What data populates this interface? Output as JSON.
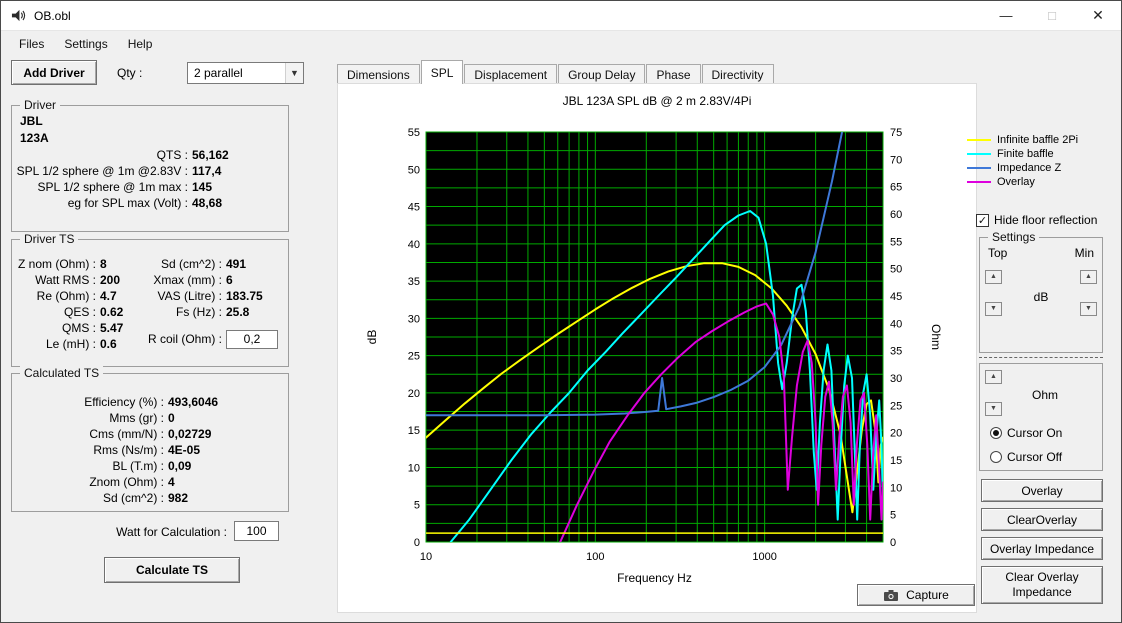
{
  "window": {
    "title": "OB.obl",
    "controls": {
      "minimize": "—",
      "maximize": "□",
      "close": "✕"
    }
  },
  "icons": {
    "spin_up": "▲",
    "spin_down": "▼",
    "combo_arrow": "▼",
    "check": "✓"
  },
  "menu": {
    "items": [
      "Files",
      "Settings",
      "Help"
    ]
  },
  "left": {
    "add_driver": "Add Driver",
    "qty_label": "Qty :",
    "qty_value": "2 parallel",
    "driver": {
      "title": "Driver",
      "name1": "JBL",
      "name2": "123A",
      "fields": [
        {
          "label": "QTS :",
          "value": "56,162"
        },
        {
          "label": "SPL 1/2 sphere @ 1m @2.83V :",
          "value": "117,4"
        },
        {
          "label": "SPL 1/2 sphere @ 1m max :",
          "value": "145"
        },
        {
          "label": "eg for SPL max (Volt) :",
          "value": "48,68"
        }
      ]
    },
    "driver_ts": {
      "title": "Driver TS",
      "col1": [
        {
          "label": "Z nom (Ohm) :",
          "value": "8"
        },
        {
          "label": "Watt RMS :",
          "value": "200"
        },
        {
          "label": "Re (Ohm) :",
          "value": "4.7"
        },
        {
          "label": "QES :",
          "value": "0.62"
        },
        {
          "label": "QMS :",
          "value": "5.47"
        },
        {
          "label": "Le (mH) :",
          "value": "0.6"
        }
      ],
      "col2": [
        {
          "label": "Sd (cm^2) :",
          "value": "491"
        },
        {
          "label": "Xmax (mm) :",
          "value": "6"
        },
        {
          "label": "VAS (Litre) :",
          "value": "183.75"
        },
        {
          "label": "Fs (Hz) :",
          "value": "25.8"
        }
      ],
      "rcoil": {
        "label": "R coil (Ohm) :",
        "value": "0,2"
      }
    },
    "calculated_ts": {
      "title": "Calculated TS",
      "fields": [
        {
          "label": "Efficiency (%) :",
          "value": "493,6046"
        },
        {
          "label": "Mms (gr) :",
          "value": "0"
        },
        {
          "label": "Cms (mm/N) :",
          "value": "0,02729"
        },
        {
          "label": "Rms (Ns/m) :",
          "value": "4E-05"
        },
        {
          "label": "BL (T.m) :",
          "value": "0,09"
        },
        {
          "label": "Znom (Ohm) :",
          "value": "4"
        },
        {
          "label": "Sd (cm^2) :",
          "value": "982"
        }
      ]
    },
    "watt_label": "Watt for Calculation :",
    "watt_value": "100",
    "calculate_button": "Calculate TS"
  },
  "tabs": {
    "active": "SPL",
    "items": [
      {
        "label": "Dimensions"
      },
      {
        "label": "SPL"
      },
      {
        "label": "Displacement"
      },
      {
        "label": "Group Delay"
      },
      {
        "label": "Phase"
      },
      {
        "label": "Directivity"
      }
    ]
  },
  "chart_data": {
    "type": "line",
    "title": "JBL 123A SPL dB @ 2 m 2.83V/4Pi",
    "xlabel": "Frequency Hz",
    "ylabel_left": "dB",
    "ylabel_right": "Ohm",
    "x_scale": "log",
    "x_range": [
      10,
      5000
    ],
    "x_ticks": [
      10,
      100,
      1000
    ],
    "y_left": {
      "range": [
        0,
        55
      ],
      "ticks": [
        0,
        5,
        10,
        15,
        20,
        25,
        30,
        35,
        40,
        45,
        50,
        55
      ],
      "grid_step": 2.5
    },
    "y_right": {
      "range": [
        0,
        75
      ],
      "ticks": [
        0,
        5,
        10,
        15,
        20,
        25,
        30,
        35,
        40,
        45,
        50,
        55,
        60,
        65,
        70,
        75
      ]
    },
    "plot_bg": "#000000",
    "grid_color": "#00aa00",
    "grid": true,
    "legend_position": "top-right-outside",
    "series": [
      {
        "name": "Infinite baffle 2Pi",
        "color": "#ffff00",
        "axis": "left",
        "width": 2,
        "points": [
          [
            10,
            14
          ],
          [
            13,
            16.3
          ],
          [
            17,
            18.6
          ],
          [
            22,
            20.7
          ],
          [
            28,
            22.6
          ],
          [
            36,
            24.4
          ],
          [
            46,
            26.1
          ],
          [
            60,
            27.9
          ],
          [
            78,
            29.6
          ],
          [
            100,
            31.2
          ],
          [
            128,
            32.7
          ],
          [
            165,
            34.1
          ],
          [
            210,
            35.3
          ],
          [
            270,
            36.3
          ],
          [
            345,
            37
          ],
          [
            440,
            37.4
          ],
          [
            560,
            37.4
          ],
          [
            700,
            36.9
          ],
          [
            880,
            35.8
          ],
          [
            1100,
            34
          ],
          [
            1350,
            31.7
          ],
          [
            1650,
            28.8
          ],
          [
            2000,
            25.2
          ],
          [
            2400,
            20.5
          ],
          [
            2800,
            14.5
          ],
          [
            3100,
            8
          ],
          [
            3300,
            4
          ],
          [
            3500,
            9
          ],
          [
            3750,
            15
          ],
          [
            4000,
            18.5
          ],
          [
            4250,
            19
          ],
          [
            4500,
            15
          ],
          [
            4700,
            8
          ],
          [
            4850,
            13
          ],
          [
            5000,
            14
          ]
        ]
      },
      {
        "name": "Finite baffle",
        "color": "#00ffff",
        "axis": "left",
        "width": 2,
        "points": [
          [
            14,
            0
          ],
          [
            18,
            3
          ],
          [
            24,
            7
          ],
          [
            32,
            11
          ],
          [
            42,
            14.5
          ],
          [
            55,
            17.5
          ],
          [
            70,
            20
          ],
          [
            90,
            23
          ],
          [
            115,
            25.5
          ],
          [
            145,
            28
          ],
          [
            185,
            30.5
          ],
          [
            235,
            33
          ],
          [
            300,
            35.5
          ],
          [
            380,
            38
          ],
          [
            480,
            40.5
          ],
          [
            580,
            42.5
          ],
          [
            700,
            43.8
          ],
          [
            820,
            44.4
          ],
          [
            920,
            43.5
          ],
          [
            1020,
            40
          ],
          [
            1120,
            33
          ],
          [
            1200,
            24
          ],
          [
            1270,
            20.5
          ],
          [
            1350,
            24
          ],
          [
            1450,
            30
          ],
          [
            1550,
            34
          ],
          [
            1650,
            34.5
          ],
          [
            1750,
            31
          ],
          [
            1850,
            23
          ],
          [
            1950,
            12
          ],
          [
            2030,
            7
          ],
          [
            2120,
            16
          ],
          [
            2230,
            23
          ],
          [
            2350,
            26.5
          ],
          [
            2480,
            23
          ],
          [
            2600,
            12
          ],
          [
            2700,
            3
          ],
          [
            2820,
            13
          ],
          [
            2950,
            21
          ],
          [
            3100,
            25
          ],
          [
            3280,
            22
          ],
          [
            3420,
            11
          ],
          [
            3520,
            3
          ],
          [
            3650,
            13
          ],
          [
            3820,
            20
          ],
          [
            4000,
            22.5
          ],
          [
            4200,
            17
          ],
          [
            4380,
            7
          ],
          [
            4550,
            14
          ],
          [
            4750,
            19
          ],
          [
            4900,
            13
          ],
          [
            5000,
            5
          ]
        ]
      },
      {
        "name": "Impedance Z",
        "color": "#3e78d8",
        "axis": "right",
        "width": 2,
        "points": [
          [
            10,
            23.2
          ],
          [
            50,
            23.2
          ],
          [
            100,
            23.3
          ],
          [
            150,
            23.5
          ],
          [
            200,
            23.8
          ],
          [
            235,
            24
          ],
          [
            248,
            30
          ],
          [
            262,
            24.3
          ],
          [
            320,
            24.8
          ],
          [
            400,
            25.5
          ],
          [
            500,
            26.5
          ],
          [
            630,
            27.8
          ],
          [
            800,
            29.5
          ],
          [
            1000,
            32
          ],
          [
            1250,
            36
          ],
          [
            1600,
            43
          ],
          [
            2000,
            53
          ],
          [
            2500,
            66
          ],
          [
            3000,
            78
          ],
          [
            3200,
            85
          ]
        ]
      },
      {
        "name": "Overlay",
        "color": "#dd00dd",
        "axis": "left",
        "width": 2,
        "points": [
          [
            62,
            0
          ],
          [
            78,
            5
          ],
          [
            98,
            9.5
          ],
          [
            122,
            13.5
          ],
          [
            155,
            17
          ],
          [
            195,
            20
          ],
          [
            245,
            22.5
          ],
          [
            310,
            24.8
          ],
          [
            390,
            26.8
          ],
          [
            490,
            28.3
          ],
          [
            610,
            29.6
          ],
          [
            760,
            30.8
          ],
          [
            900,
            31.6
          ],
          [
            1020,
            32
          ],
          [
            1120,
            30.5
          ],
          [
            1220,
            27.5
          ],
          [
            1300,
            22
          ],
          [
            1370,
            7
          ],
          [
            1450,
            14
          ],
          [
            1550,
            21
          ],
          [
            1680,
            25.5
          ],
          [
            1790,
            27
          ],
          [
            1900,
            24
          ],
          [
            2000,
            16
          ],
          [
            2070,
            5
          ],
          [
            2160,
            13
          ],
          [
            2280,
            19.5
          ],
          [
            2400,
            21.5
          ],
          [
            2520,
            16
          ],
          [
            2640,
            7
          ],
          [
            2760,
            14
          ],
          [
            2900,
            19.5
          ],
          [
            3060,
            21
          ],
          [
            3220,
            16
          ],
          [
            3360,
            5
          ],
          [
            3500,
            13
          ],
          [
            3680,
            19
          ],
          [
            3860,
            20
          ],
          [
            4040,
            13
          ],
          [
            4200,
            3
          ],
          [
            4380,
            12
          ],
          [
            4560,
            17
          ],
          [
            4740,
            10
          ],
          [
            4900,
            3
          ],
          [
            5000,
            8
          ]
        ]
      },
      {
        "name": "",
        "color": "#ffff00",
        "axis": "left",
        "width": 1.5,
        "legend": false,
        "points": [
          [
            10,
            1.2
          ],
          [
            5000,
            1.2
          ]
        ]
      }
    ]
  },
  "right": {
    "hide_floor": "Hide floor reflection",
    "settings": {
      "title": "Settings",
      "top_label": "Top",
      "min_label": "Min",
      "db_label": "dB"
    },
    "ohm_label": "Ohm",
    "cursor_on": "Cursor On",
    "cursor_off": "Cursor Off",
    "buttons": {
      "overlay": "Overlay",
      "clear_overlay": "ClearOverlay",
      "overlay_impedance": "Overlay Impedance",
      "clear_overlay_impedance": "Clear Overlay Impedance"
    },
    "capture": "Capture"
  }
}
